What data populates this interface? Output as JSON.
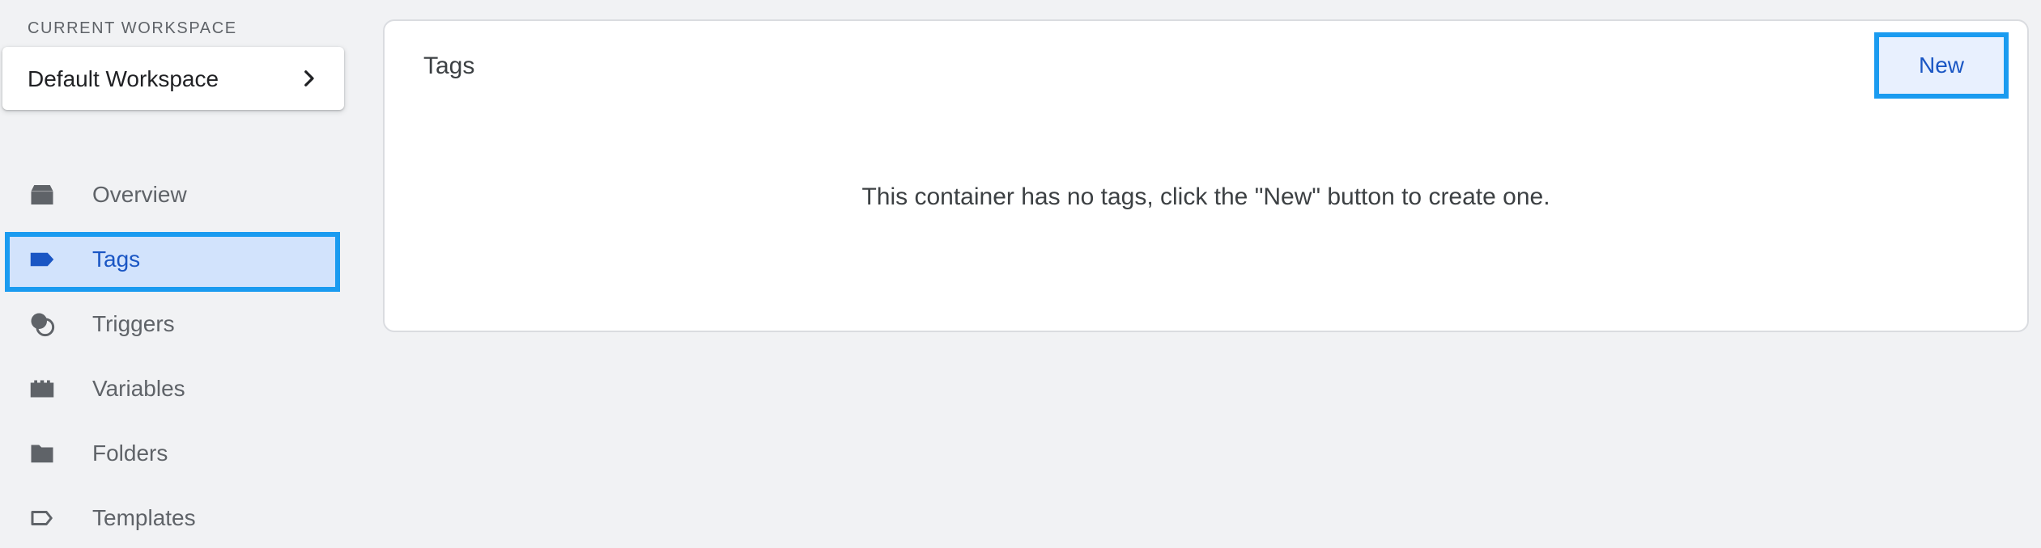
{
  "workspace": {
    "section_label": "CURRENT WORKSPACE",
    "name": "Default Workspace",
    "chevron_icon": "chevron-right-icon"
  },
  "sidebar": {
    "items": [
      {
        "label": "Overview",
        "icon": "overview-icon",
        "active": false
      },
      {
        "label": "Tags",
        "icon": "tag-icon",
        "active": true
      },
      {
        "label": "Triggers",
        "icon": "trigger-icon",
        "active": false
      },
      {
        "label": "Variables",
        "icon": "variables-icon",
        "active": false
      },
      {
        "label": "Folders",
        "icon": "folder-icon",
        "active": false
      },
      {
        "label": "Templates",
        "icon": "template-icon",
        "active": false
      }
    ]
  },
  "main": {
    "title": "Tags",
    "new_button_label": "New",
    "empty_message": "This container has no tags, click the \"New\" button to create one."
  },
  "colors": {
    "background": "#f1f2f4",
    "accent_blue": "#1a56c4",
    "highlight_border": "#1a9bf0",
    "active_item_bg": "#d2e3fc",
    "icon_gray": "#5f6368"
  }
}
